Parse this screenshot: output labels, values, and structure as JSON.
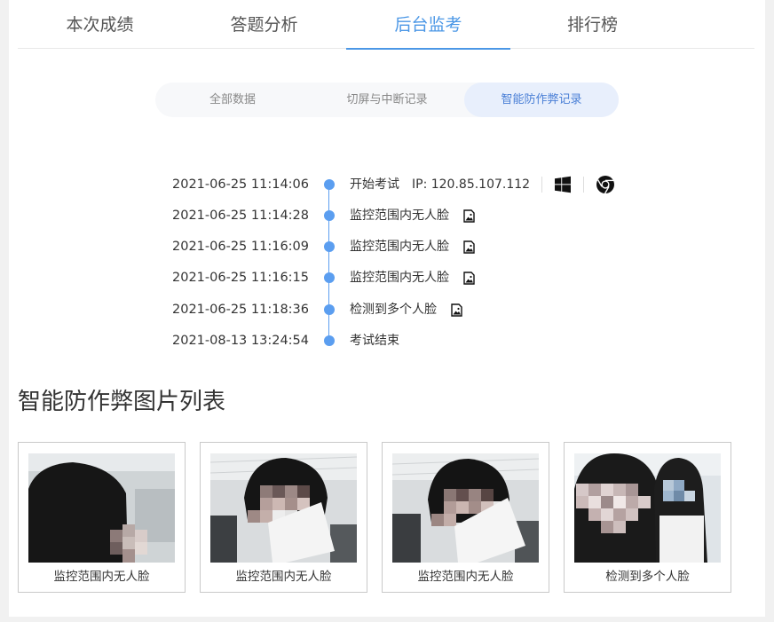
{
  "top_tabs": [
    {
      "label": "本次成绩"
    },
    {
      "label": "答题分析"
    },
    {
      "label": "后台监考"
    },
    {
      "label": "排行榜"
    }
  ],
  "active_top_tab": "后台监考",
  "sub_tabs": [
    {
      "label": "全部数据"
    },
    {
      "label": "切屏与中断记录"
    },
    {
      "label": "智能防作弊记录"
    }
  ],
  "active_sub_tab": "智能防作弊记录",
  "timeline": [
    {
      "time": "2021-06-25 11:14:06",
      "event": "开始考试",
      "ip": "IP: 120.85.107.112",
      "os_icon": "windows-icon",
      "browser_icon": "chrome-icon"
    },
    {
      "time": "2021-06-25 11:14:28",
      "event": "监控范围内无人脸",
      "icon": "image-icon"
    },
    {
      "time": "2021-06-25 11:16:09",
      "event": "监控范围内无人脸",
      "icon": "image-icon"
    },
    {
      "time": "2021-06-25 11:16:15",
      "event": "监控范围内无人脸",
      "icon": "image-icon"
    },
    {
      "time": "2021-06-25 11:18:36",
      "event": "检测到多个人脸",
      "icon": "image-icon"
    },
    {
      "time": "2021-08-13 13:24:54",
      "event": "考试结束"
    }
  ],
  "gallery": {
    "title": "智能防作弊图片列表",
    "items": [
      {
        "caption": "监控范围内无人脸"
      },
      {
        "caption": "监控范围内无人脸"
      },
      {
        "caption": "监控范围内无人脸"
      },
      {
        "caption": "检测到多个人脸"
      }
    ]
  },
  "colors": {
    "accent": "#4b97e6",
    "timeline": "#5b9ef0",
    "sub_tab_active_bg": "#e8effc"
  }
}
